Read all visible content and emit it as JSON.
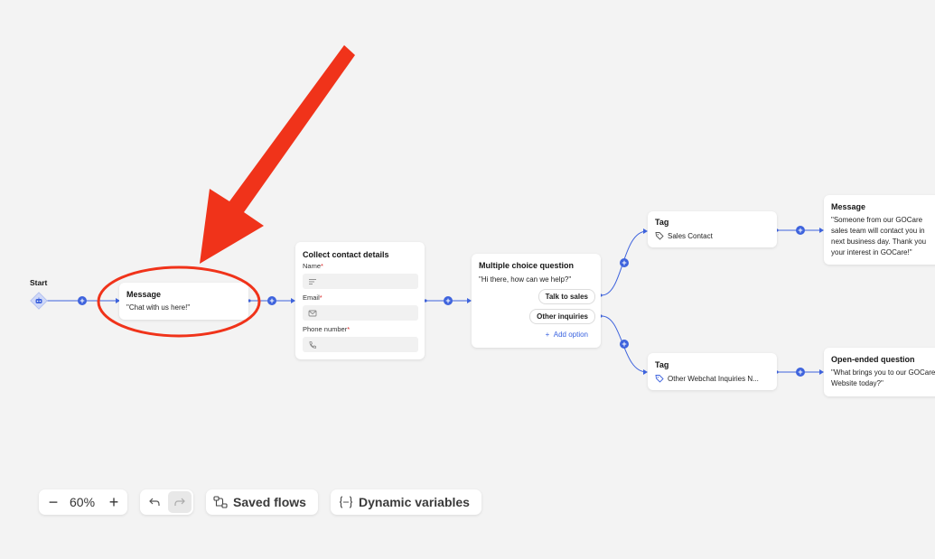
{
  "canvas": {
    "start": {
      "label": "Start"
    },
    "nodes": {
      "message1": {
        "title": "Message",
        "text": "\"Chat with us here!\""
      },
      "collect": {
        "title": "Collect contact details",
        "fields": [
          {
            "label": "Name",
            "icon": "text-lines-icon"
          },
          {
            "label": "Email",
            "icon": "envelope-icon"
          },
          {
            "label": "Phone number",
            "icon": "phone-icon"
          }
        ],
        "required_mark": "*"
      },
      "mcq": {
        "title": "Multiple choice question",
        "question": "\"Hi there, how can we help?\"",
        "options": [
          "Talk to sales",
          "Other inquiries"
        ],
        "add_option": "Add option",
        "add_option_symbol": "+"
      },
      "tag1": {
        "title": "Tag",
        "text": "Sales Contact"
      },
      "tag2": {
        "title": "Tag",
        "text": "Other Webchat Inquiries N..."
      },
      "message2": {
        "title": "Message",
        "lines": [
          "\"Someone from our GOCare",
          "sales team will contact you in",
          "next business day. Thank you",
          "your interest in GOCare!\""
        ]
      },
      "openq": {
        "title": "Open-ended question",
        "lines": [
          "\"What brings you to our GOCare",
          "Website today?\""
        ]
      }
    },
    "connector_plus": "+"
  },
  "toolbar": {
    "zoom_out": "−",
    "zoom_level": "60%",
    "zoom_in": "+",
    "undo_icon": "undo-icon",
    "redo_icon": "redo-icon",
    "saved_flows": "Saved flows",
    "dynamic_variables": "Dynamic variables"
  },
  "colors": {
    "accent": "#3e63dd",
    "annotation_red": "#f0331a",
    "background": "#f3f3f3"
  }
}
